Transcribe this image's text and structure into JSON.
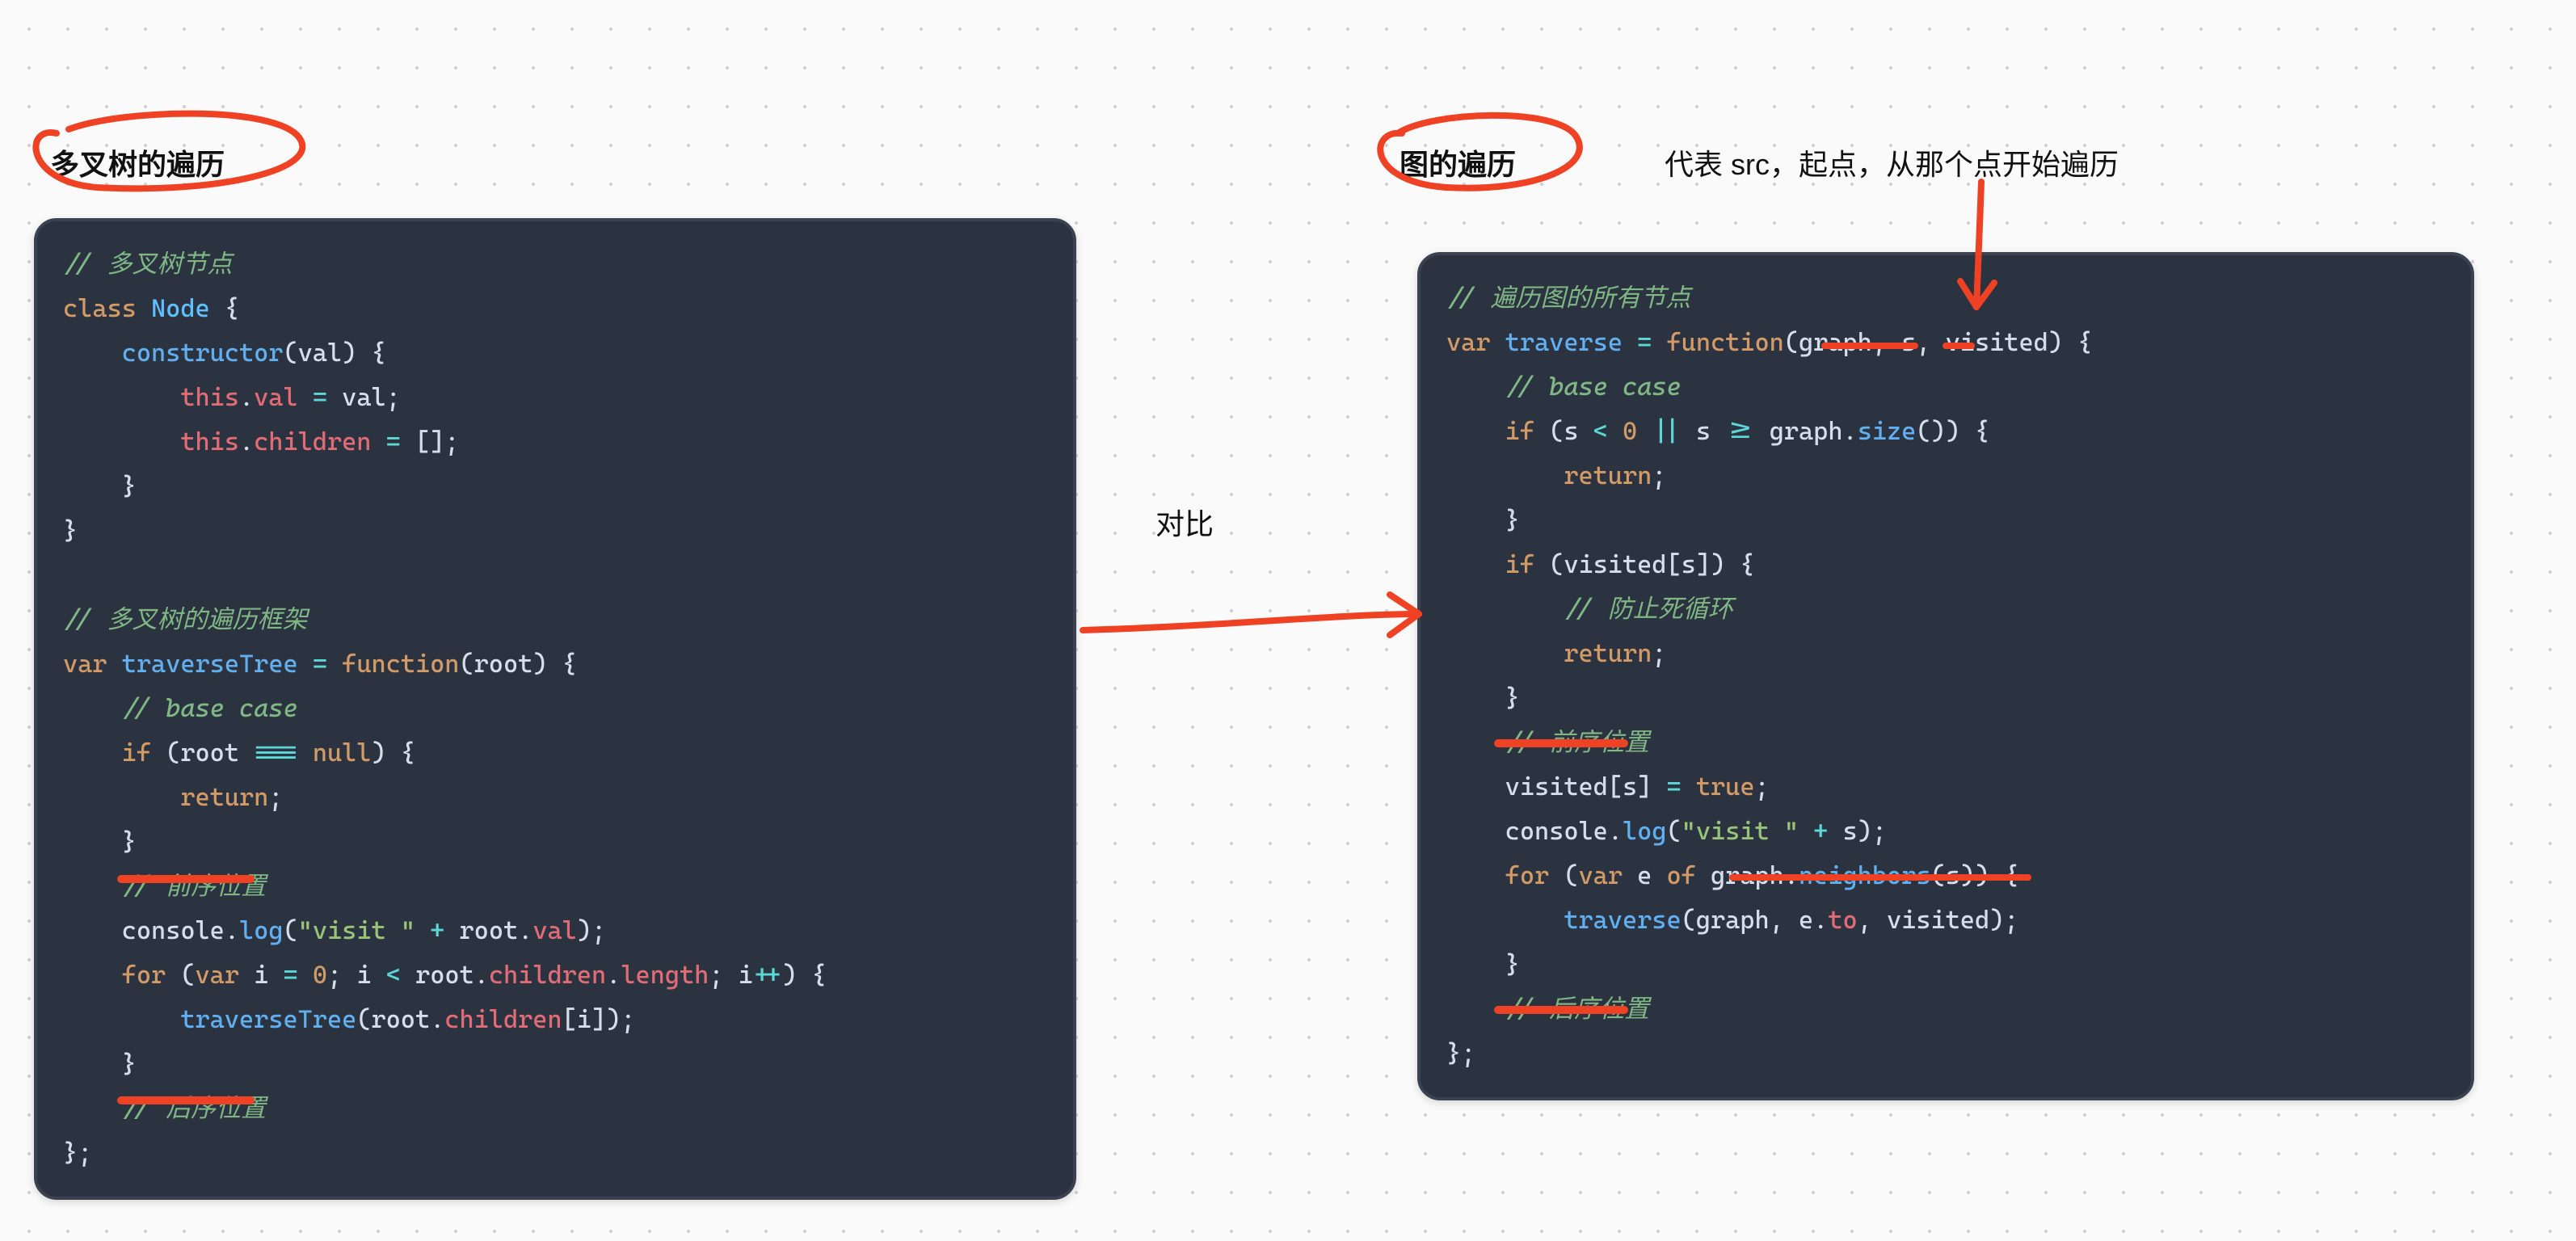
{
  "left": {
    "title": "多叉树的遍历",
    "code_lines": [
      {
        "type": "comment",
        "text": "// 多叉树节点"
      },
      {
        "type": "line",
        "tokens": [
          {
            "c": "c-cls",
            "t": "class"
          },
          {
            "c": "",
            "t": " "
          },
          {
            "c": "c-cn",
            "t": "Node"
          },
          {
            "c": "",
            "t": " {"
          }
        ]
      },
      {
        "type": "line",
        "tokens": [
          {
            "c": "",
            "t": "    "
          },
          {
            "c": "c-fn",
            "t": "constructor"
          },
          {
            "c": "",
            "t": "("
          },
          {
            "c": "c-id",
            "t": "val"
          },
          {
            "c": "",
            "t": ") {"
          }
        ]
      },
      {
        "type": "line",
        "tokens": [
          {
            "c": "",
            "t": "        "
          },
          {
            "c": "c-this",
            "t": "this"
          },
          {
            "c": "",
            "t": "."
          },
          {
            "c": "c-prop",
            "t": "val"
          },
          {
            "c": "",
            "t": " "
          },
          {
            "c": "c-op",
            "t": "="
          },
          {
            "c": "",
            "t": " "
          },
          {
            "c": "c-id",
            "t": "val"
          },
          {
            "c": "",
            "t": ";"
          }
        ]
      },
      {
        "type": "line",
        "tokens": [
          {
            "c": "",
            "t": "        "
          },
          {
            "c": "c-this",
            "t": "this"
          },
          {
            "c": "",
            "t": "."
          },
          {
            "c": "c-prop",
            "t": "children"
          },
          {
            "c": "",
            "t": " "
          },
          {
            "c": "c-op",
            "t": "="
          },
          {
            "c": "",
            "t": " [];"
          }
        ]
      },
      {
        "type": "line",
        "tokens": [
          {
            "c": "",
            "t": "    }"
          }
        ]
      },
      {
        "type": "line",
        "tokens": [
          {
            "c": "",
            "t": "}"
          }
        ]
      },
      {
        "type": "blank"
      },
      {
        "type": "comment",
        "text": "// 多叉树的遍历框架"
      },
      {
        "type": "line",
        "tokens": [
          {
            "c": "c-kw",
            "t": "var"
          },
          {
            "c": "",
            "t": " "
          },
          {
            "c": "c-fn",
            "t": "traverseTree"
          },
          {
            "c": "",
            "t": " "
          },
          {
            "c": "c-op",
            "t": "="
          },
          {
            "c": "",
            "t": " "
          },
          {
            "c": "c-kw",
            "t": "function"
          },
          {
            "c": "",
            "t": "("
          },
          {
            "c": "c-id",
            "t": "root"
          },
          {
            "c": "",
            "t": ") {"
          }
        ]
      },
      {
        "type": "line",
        "tokens": [
          {
            "c": "",
            "t": "    "
          },
          {
            "c": "c-cm",
            "t": "// base case"
          }
        ]
      },
      {
        "type": "line",
        "tokens": [
          {
            "c": "",
            "t": "    "
          },
          {
            "c": "c-kw",
            "t": "if"
          },
          {
            "c": "",
            "t": " ("
          },
          {
            "c": "c-id",
            "t": "root"
          },
          {
            "c": "",
            "t": " "
          },
          {
            "c": "c-op",
            "t": "==="
          },
          {
            "c": "",
            "t": " "
          },
          {
            "c": "c-null",
            "t": "null"
          },
          {
            "c": "",
            "t": ") {"
          }
        ]
      },
      {
        "type": "line",
        "tokens": [
          {
            "c": "",
            "t": "        "
          },
          {
            "c": "c-kw",
            "t": "return"
          },
          {
            "c": "",
            "t": ";"
          }
        ]
      },
      {
        "type": "line",
        "tokens": [
          {
            "c": "",
            "t": "    }"
          }
        ]
      },
      {
        "type": "line",
        "tokens": [
          {
            "c": "",
            "t": "    "
          },
          {
            "c": "c-cm",
            "t": "// 前序位置"
          }
        ]
      },
      {
        "type": "line",
        "tokens": [
          {
            "c": "",
            "t": "    "
          },
          {
            "c": "c-id",
            "t": "console"
          },
          {
            "c": "",
            "t": "."
          },
          {
            "c": "c-fn",
            "t": "log"
          },
          {
            "c": "",
            "t": "("
          },
          {
            "c": "c-str",
            "t": "\"visit \""
          },
          {
            "c": "",
            "t": " "
          },
          {
            "c": "c-op",
            "t": "+"
          },
          {
            "c": "",
            "t": " "
          },
          {
            "c": "c-id",
            "t": "root"
          },
          {
            "c": "",
            "t": "."
          },
          {
            "c": "c-prop",
            "t": "val"
          },
          {
            "c": "",
            "t": ");"
          }
        ]
      },
      {
        "type": "line",
        "tokens": [
          {
            "c": "",
            "t": "    "
          },
          {
            "c": "c-kw",
            "t": "for"
          },
          {
            "c": "",
            "t": " ("
          },
          {
            "c": "c-kw",
            "t": "var"
          },
          {
            "c": "",
            "t": " "
          },
          {
            "c": "c-id",
            "t": "i"
          },
          {
            "c": "",
            "t": " "
          },
          {
            "c": "c-op",
            "t": "="
          },
          {
            "c": "",
            "t": " "
          },
          {
            "c": "c-num",
            "t": "0"
          },
          {
            "c": "",
            "t": "; "
          },
          {
            "c": "c-id",
            "t": "i"
          },
          {
            "c": "",
            "t": " "
          },
          {
            "c": "c-op",
            "t": "<"
          },
          {
            "c": "",
            "t": " "
          },
          {
            "c": "c-id",
            "t": "root"
          },
          {
            "c": "",
            "t": "."
          },
          {
            "c": "c-prop",
            "t": "children"
          },
          {
            "c": "",
            "t": "."
          },
          {
            "c": "c-prop",
            "t": "length"
          },
          {
            "c": "",
            "t": "; "
          },
          {
            "c": "c-id",
            "t": "i"
          },
          {
            "c": "c-op",
            "t": "++"
          },
          {
            "c": "",
            "t": ") {"
          }
        ]
      },
      {
        "type": "line",
        "tokens": [
          {
            "c": "",
            "t": "        "
          },
          {
            "c": "c-fn",
            "t": "traverseTree"
          },
          {
            "c": "",
            "t": "("
          },
          {
            "c": "c-id",
            "t": "root"
          },
          {
            "c": "",
            "t": "."
          },
          {
            "c": "c-prop",
            "t": "children"
          },
          {
            "c": "",
            "t": "["
          },
          {
            "c": "c-id",
            "t": "i"
          },
          {
            "c": "",
            "t": "]);"
          }
        ]
      },
      {
        "type": "line",
        "tokens": [
          {
            "c": "",
            "t": "    }"
          }
        ]
      },
      {
        "type": "line",
        "tokens": [
          {
            "c": "",
            "t": "    "
          },
          {
            "c": "c-cm",
            "t": "// 后序位置"
          }
        ]
      },
      {
        "type": "line",
        "tokens": [
          {
            "c": "",
            "t": "};"
          }
        ]
      }
    ]
  },
  "right": {
    "title": "图的遍历",
    "code_lines": [
      {
        "type": "comment",
        "text": "// 遍历图的所有节点"
      },
      {
        "type": "line",
        "tokens": [
          {
            "c": "c-kw",
            "t": "var"
          },
          {
            "c": "",
            "t": " "
          },
          {
            "c": "c-fn",
            "t": "traverse"
          },
          {
            "c": "",
            "t": " "
          },
          {
            "c": "c-op",
            "t": "="
          },
          {
            "c": "",
            "t": " "
          },
          {
            "c": "c-kw",
            "t": "function"
          },
          {
            "c": "",
            "t": "("
          },
          {
            "c": "c-id",
            "t": "graph"
          },
          {
            "c": "",
            "t": ", "
          },
          {
            "c": "c-id",
            "t": "s"
          },
          {
            "c": "",
            "t": ", "
          },
          {
            "c": "c-id",
            "t": "visited"
          },
          {
            "c": "",
            "t": ") {"
          }
        ]
      },
      {
        "type": "line",
        "tokens": [
          {
            "c": "",
            "t": "    "
          },
          {
            "c": "c-cm",
            "t": "// base case"
          }
        ]
      },
      {
        "type": "line",
        "tokens": [
          {
            "c": "",
            "t": "    "
          },
          {
            "c": "c-kw",
            "t": "if"
          },
          {
            "c": "",
            "t": " ("
          },
          {
            "c": "c-id",
            "t": "s"
          },
          {
            "c": "",
            "t": " "
          },
          {
            "c": "c-op",
            "t": "<"
          },
          {
            "c": "",
            "t": " "
          },
          {
            "c": "c-num",
            "t": "0"
          },
          {
            "c": "",
            "t": " "
          },
          {
            "c": "c-op",
            "t": "||"
          },
          {
            "c": "",
            "t": " "
          },
          {
            "c": "c-id",
            "t": "s"
          },
          {
            "c": "",
            "t": " "
          },
          {
            "c": "c-op",
            "t": ">="
          },
          {
            "c": "",
            "t": " "
          },
          {
            "c": "c-id",
            "t": "graph"
          },
          {
            "c": "",
            "t": "."
          },
          {
            "c": "c-fn",
            "t": "size"
          },
          {
            "c": "",
            "t": "()) {"
          }
        ]
      },
      {
        "type": "line",
        "tokens": [
          {
            "c": "",
            "t": "        "
          },
          {
            "c": "c-kw",
            "t": "return"
          },
          {
            "c": "",
            "t": ";"
          }
        ]
      },
      {
        "type": "line",
        "tokens": [
          {
            "c": "",
            "t": "    }"
          }
        ]
      },
      {
        "type": "line",
        "tokens": [
          {
            "c": "",
            "t": "    "
          },
          {
            "c": "c-kw",
            "t": "if"
          },
          {
            "c": "",
            "t": " ("
          },
          {
            "c": "c-id",
            "t": "visited"
          },
          {
            "c": "",
            "t": "["
          },
          {
            "c": "c-id",
            "t": "s"
          },
          {
            "c": "",
            "t": "]) {"
          }
        ]
      },
      {
        "type": "line",
        "tokens": [
          {
            "c": "",
            "t": "        "
          },
          {
            "c": "c-cm",
            "t": "// 防止死循环"
          }
        ]
      },
      {
        "type": "line",
        "tokens": [
          {
            "c": "",
            "t": "        "
          },
          {
            "c": "c-kw",
            "t": "return"
          },
          {
            "c": "",
            "t": ";"
          }
        ]
      },
      {
        "type": "line",
        "tokens": [
          {
            "c": "",
            "t": "    }"
          }
        ]
      },
      {
        "type": "line",
        "tokens": [
          {
            "c": "",
            "t": "    "
          },
          {
            "c": "c-cm",
            "t": "// 前序位置"
          }
        ]
      },
      {
        "type": "line",
        "tokens": [
          {
            "c": "",
            "t": "    "
          },
          {
            "c": "c-id",
            "t": "visited"
          },
          {
            "c": "",
            "t": "["
          },
          {
            "c": "c-id",
            "t": "s"
          },
          {
            "c": "",
            "t": "] "
          },
          {
            "c": "c-op",
            "t": "="
          },
          {
            "c": "",
            "t": " "
          },
          {
            "c": "c-null",
            "t": "true"
          },
          {
            "c": "",
            "t": ";"
          }
        ]
      },
      {
        "type": "line",
        "tokens": [
          {
            "c": "",
            "t": "    "
          },
          {
            "c": "c-id",
            "t": "console"
          },
          {
            "c": "",
            "t": "."
          },
          {
            "c": "c-fn",
            "t": "log"
          },
          {
            "c": "",
            "t": "("
          },
          {
            "c": "c-str",
            "t": "\"visit \""
          },
          {
            "c": "",
            "t": " "
          },
          {
            "c": "c-op",
            "t": "+"
          },
          {
            "c": "",
            "t": " "
          },
          {
            "c": "c-id",
            "t": "s"
          },
          {
            "c": "",
            "t": ");"
          }
        ]
      },
      {
        "type": "line",
        "tokens": [
          {
            "c": "",
            "t": "    "
          },
          {
            "c": "c-kw",
            "t": "for"
          },
          {
            "c": "",
            "t": " ("
          },
          {
            "c": "c-kw",
            "t": "var"
          },
          {
            "c": "",
            "t": " "
          },
          {
            "c": "c-id",
            "t": "e"
          },
          {
            "c": "",
            "t": " "
          },
          {
            "c": "c-kw",
            "t": "of"
          },
          {
            "c": "",
            "t": " "
          },
          {
            "c": "c-id",
            "t": "graph"
          },
          {
            "c": "",
            "t": "."
          },
          {
            "c": "c-fn",
            "t": "neighbors"
          },
          {
            "c": "",
            "t": "("
          },
          {
            "c": "c-id",
            "t": "s"
          },
          {
            "c": "",
            "t": ")) {"
          }
        ]
      },
      {
        "type": "line",
        "tokens": [
          {
            "c": "",
            "t": "        "
          },
          {
            "c": "c-fn",
            "t": "traverse"
          },
          {
            "c": "",
            "t": "("
          },
          {
            "c": "c-id",
            "t": "graph"
          },
          {
            "c": "",
            "t": ", "
          },
          {
            "c": "c-id",
            "t": "e"
          },
          {
            "c": "",
            "t": "."
          },
          {
            "c": "c-prop",
            "t": "to"
          },
          {
            "c": "",
            "t": ", "
          },
          {
            "c": "c-id",
            "t": "visited"
          },
          {
            "c": "",
            "t": ");"
          }
        ]
      },
      {
        "type": "line",
        "tokens": [
          {
            "c": "",
            "t": "    }"
          }
        ]
      },
      {
        "type": "line",
        "tokens": [
          {
            "c": "",
            "t": "    "
          },
          {
            "c": "c-cm",
            "t": "// 后序位置"
          }
        ]
      },
      {
        "type": "line",
        "tokens": [
          {
            "c": "",
            "t": "};"
          }
        ]
      }
    ]
  },
  "labels": {
    "compare": "对比",
    "src_note": "代表 src，起点，从那个点开始遍历"
  },
  "colors": {
    "annotation_red": "#ef4123",
    "code_bg": "#2b3240"
  }
}
